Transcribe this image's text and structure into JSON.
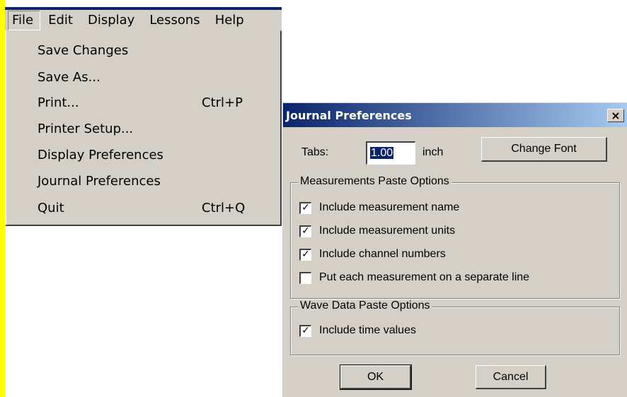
{
  "menubar": {
    "items": [
      "File",
      "Edit",
      "Display",
      "Lessons",
      "Help"
    ]
  },
  "file_menu": {
    "items": [
      {
        "label": "Save Changes",
        "shortcut": ""
      },
      {
        "label": "Save As...",
        "shortcut": ""
      },
      {
        "label": "Print...",
        "shortcut": "Ctrl+P"
      },
      {
        "label": "Printer Setup...",
        "shortcut": ""
      },
      {
        "label": "Display Preferences",
        "shortcut": ""
      },
      {
        "label": "Journal Preferences",
        "shortcut": ""
      },
      {
        "label": "Quit",
        "shortcut": "Ctrl+Q"
      }
    ]
  },
  "dialog": {
    "title": "Journal Preferences",
    "close_glyph": "×",
    "tabs_label": "Tabs:",
    "tabs_value": "1.00",
    "tabs_unit": "inch",
    "change_font_label": "Change Font",
    "measurements_group": {
      "title": "Measurements Paste Options",
      "options": [
        {
          "label": "Include measurement name",
          "checked": true
        },
        {
          "label": "Include measurement units",
          "checked": true
        },
        {
          "label": "Include channel numbers",
          "checked": true
        },
        {
          "label": "Put each measurement on a separate line",
          "checked": false
        }
      ]
    },
    "wave_group": {
      "title": "Wave Data Paste Options",
      "options": [
        {
          "label": "Include time values",
          "checked": true
        }
      ]
    },
    "ok_label": "OK",
    "cancel_label": "Cancel",
    "check_glyph": "✓"
  }
}
